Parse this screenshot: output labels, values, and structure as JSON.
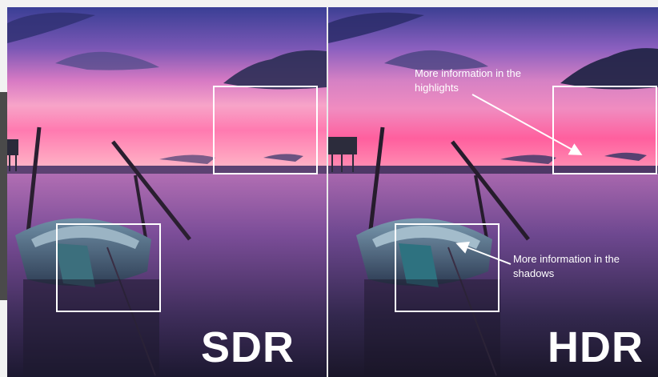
{
  "panels": {
    "sdr": {
      "label": "SDR"
    },
    "hdr": {
      "label": "HDR"
    }
  },
  "annotations": {
    "highlights": "More information in the\nhighlights",
    "shadows": "More information in the\nshadows"
  },
  "colors": {
    "sky_top": "#3b3a8c",
    "sky_mid": "#c470c4",
    "horizon_pink": "#ff6aa8",
    "water_dark": "#2a2440",
    "frame": "#ffffff"
  },
  "icons": {
    "arrow": "arrow-icon"
  }
}
